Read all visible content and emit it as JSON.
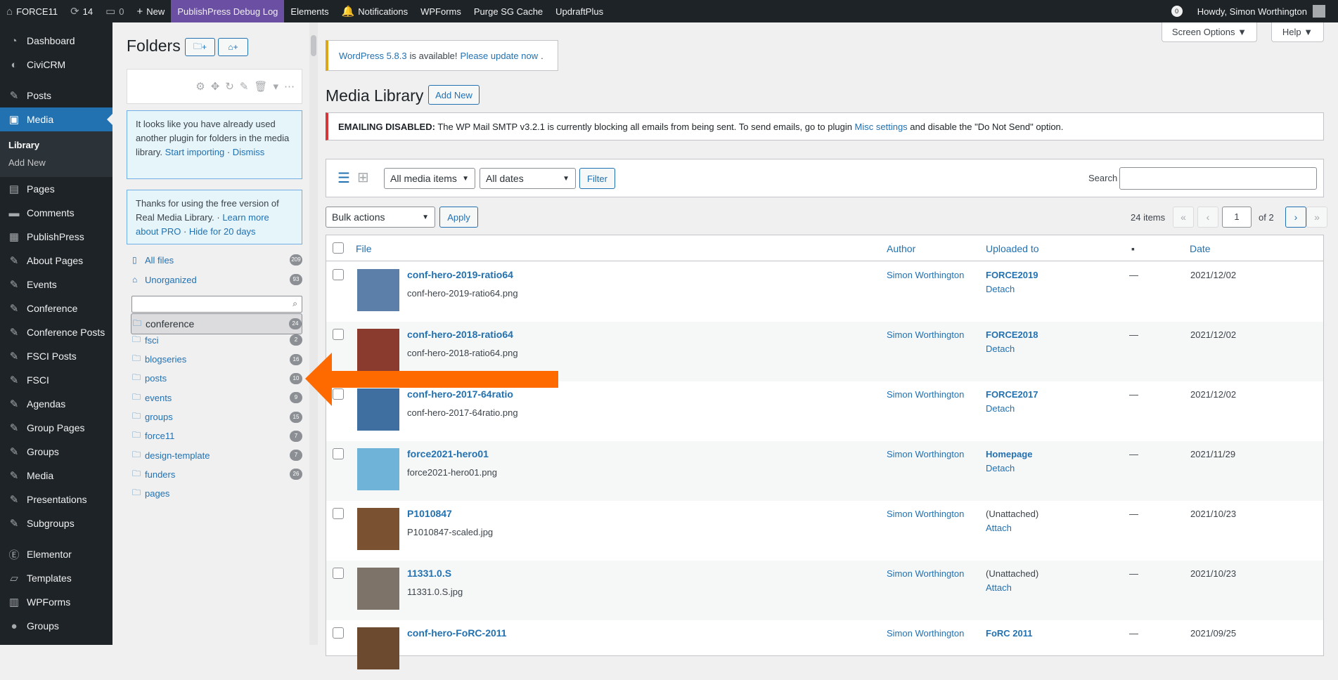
{
  "adminbar": {
    "site": "FORCE11",
    "updates": "14",
    "comments": "0",
    "new": "New",
    "debug": "PublishPress Debug Log",
    "elements": "Elements",
    "notifications": "Notifications",
    "wpforms": "WPForms",
    "purge": "Purge SG Cache",
    "updraft": "UpdraftPlus",
    "notif_count": "0",
    "howdy": "Howdy, Simon Worthington"
  },
  "menu": {
    "dashboard": "Dashboard",
    "civicrm": "CiviCRM",
    "posts": "Posts",
    "media": "Media",
    "library": "Library",
    "addnew": "Add New",
    "pages": "Pages",
    "comments": "Comments",
    "publishpress": "PublishPress",
    "aboutpages": "About Pages",
    "events": "Events",
    "conference": "Conference",
    "confposts": "Conference Posts",
    "fsciposts": "FSCI Posts",
    "fsci": "FSCI",
    "agendas": "Agendas",
    "grouppages": "Group Pages",
    "groups": "Groups",
    "media2": "Media",
    "presentations": "Presentations",
    "subgroups": "Subgroups",
    "elementor": "Elementor",
    "templates": "Templates",
    "wpforms": "WPForms",
    "groups2": "Groups"
  },
  "folders": {
    "title": "Folders",
    "btn1": "+",
    "btn2": "+",
    "notice1": {
      "text": "It looks like you have already used another plugin for folders in the media library. ",
      "link": "Start importing",
      "sep": " · ",
      "dismiss": "Dismiss"
    },
    "notice2": {
      "text": "Thanks for using the free version of Real Media Library. · ",
      "link": "Learn more about PRO",
      "sep": " · ",
      "hide": "Hide for 20 days"
    },
    "allfiles": "All files",
    "allcount": "209",
    "unorg": "Unorganized",
    "unorgcount": "93",
    "list": [
      {
        "name": "conference",
        "count": "24"
      },
      {
        "name": "fsci",
        "count": "2"
      },
      {
        "name": "blogseries",
        "count": "16"
      },
      {
        "name": "posts",
        "count": "10"
      },
      {
        "name": "events",
        "count": "9"
      },
      {
        "name": "groups",
        "count": "15"
      },
      {
        "name": "force11",
        "count": "7"
      },
      {
        "name": "design-template",
        "count": "7"
      },
      {
        "name": "funders",
        "count": "26"
      },
      {
        "name": "pages",
        "count": ""
      }
    ]
  },
  "main": {
    "screen_options": "Screen Options ▼",
    "help": "Help ▼",
    "update_link": "WordPress 5.8.3",
    "update_text": "is available!",
    "update_cta": "Please update now",
    "update_dot": ".",
    "title": "Media Library",
    "add_new": "Add New",
    "email_bold": "EMAILING DISABLED:",
    "email_text": " The WP Mail SMTP v3.2.1 is currently blocking all emails from being sent. To send emails, go to plugin ",
    "email_link": "Misc settings",
    "email_end": " and disable the \"Do Not Send\" option.",
    "filter_type": "All media items",
    "filter_date": "All dates",
    "filter_btn": "Filter",
    "search_label": "Search",
    "bulk": "Bulk actions",
    "apply": "Apply",
    "items": "24 items",
    "page": "1",
    "of": "of 2",
    "col_file": "File",
    "col_author": "Author",
    "col_uploaded": "Uploaded to",
    "col_date": "Date",
    "rows": [
      {
        "title": "conf-hero-2019-ratio64",
        "file": "conf-hero-2019-ratio64.png",
        "author": "Simon Worthington",
        "up": "FORCE2019",
        "act": "Detach",
        "c": "—",
        "date": "2021/12/02",
        "color": "#5b7fa8"
      },
      {
        "title": "conf-hero-2018-ratio64",
        "file": "conf-hero-2018-ratio64.png",
        "author": "Simon Worthington",
        "up": "FORCE2018",
        "act": "Detach",
        "c": "—",
        "date": "2021/12/02",
        "color": "#8a3b2e"
      },
      {
        "title": "conf-hero-2017-64ratio",
        "file": "conf-hero-2017-64ratio.png",
        "author": "Simon Worthington",
        "up": "FORCE2017",
        "act": "Detach",
        "c": "—",
        "date": "2021/12/02",
        "color": "#3f6fa1"
      },
      {
        "title": "force2021-hero01",
        "file": "force2021-hero01.png",
        "author": "Simon Worthington",
        "up": "Homepage",
        "act": "Detach",
        "c": "—",
        "date": "2021/11/29",
        "color": "#6fb3d9"
      },
      {
        "title": "P1010847",
        "file": "P1010847-scaled.jpg",
        "author": "Simon Worthington",
        "up": "(Unattached)",
        "act": "Attach",
        "c": "—",
        "date": "2021/10/23",
        "color": "#7a5232"
      },
      {
        "title": "11331.0.S",
        "file": "11331.0.S.jpg",
        "author": "Simon Worthington",
        "up": "(Unattached)",
        "act": "Attach",
        "c": "—",
        "date": "2021/10/23",
        "color": "#7d7368"
      },
      {
        "title": "conf-hero-FoRC-2011",
        "file": "",
        "author": "Simon Worthington",
        "up": "FoRC 2011",
        "act": "",
        "c": "—",
        "date": "2021/09/25",
        "color": "#6b4a30"
      }
    ]
  }
}
